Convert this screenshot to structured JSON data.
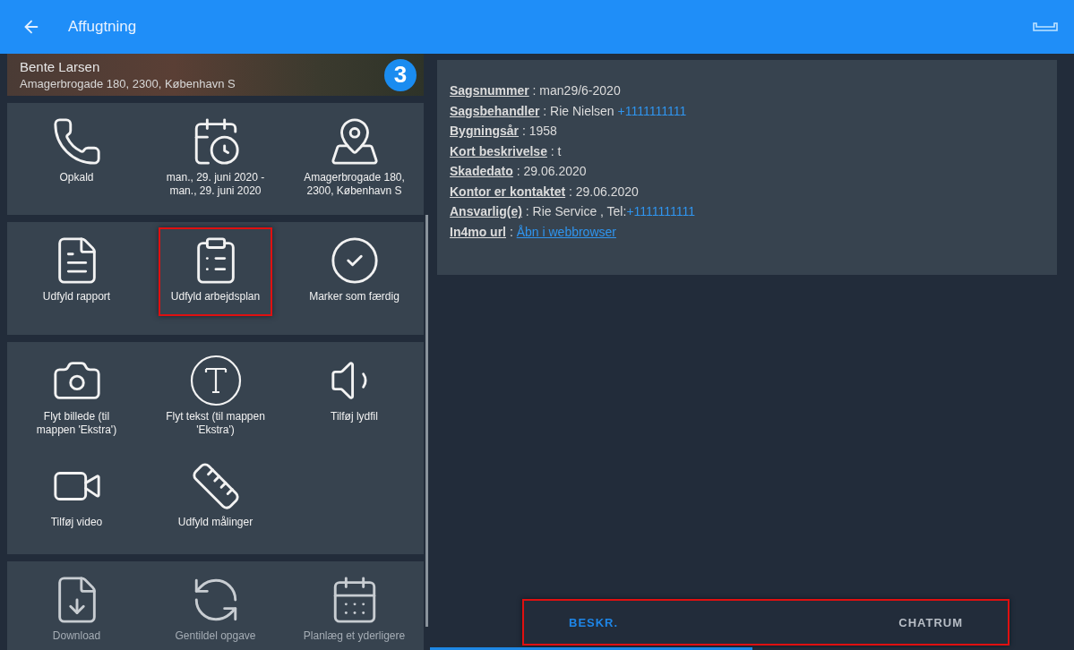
{
  "app_bar": {
    "title": "Affugtning"
  },
  "header": {
    "name": "Bente Larsen",
    "address": "Amagerbrogade 180, 2300, København S",
    "badge": "3"
  },
  "action_cards": [
    {
      "actions": [
        {
          "label": "Opkald",
          "highlighted": false
        },
        {
          "label": "man., 29. juni 2020 - man., 29. juni 2020",
          "highlighted": false
        },
        {
          "label": "Amagerbrogade 180, 2300, København S",
          "highlighted": false
        }
      ]
    },
    {
      "actions": [
        {
          "label": "Udfyld rapport",
          "highlighted": false
        },
        {
          "label": "Udfyld arbejdsplan",
          "highlighted": true
        },
        {
          "label": "Marker som færdig",
          "highlighted": false
        }
      ]
    },
    {
      "actions": [
        {
          "label": "Flyt billede (til mappen 'Ekstra')",
          "highlighted": false
        },
        {
          "label": "Flyt tekst (til mappen 'Ekstra')",
          "highlighted": false
        },
        {
          "label": "Tilføj lydfil",
          "highlighted": false
        },
        {
          "label": "Tilføj video",
          "highlighted": false
        },
        {
          "label": "Udfyld målinger",
          "highlighted": false
        }
      ]
    },
    {
      "actions": [
        {
          "label": "Download",
          "highlighted": false
        },
        {
          "label": "Gentildel opgave",
          "highlighted": false
        },
        {
          "label": "Planlæg et yderligere",
          "highlighted": false
        }
      ]
    }
  ],
  "details": [
    {
      "label": "Sagsnummer",
      "value": " : man29/6-2020"
    },
    {
      "label": "Sagsbehandler",
      "value": " : Rie Nielsen ",
      "link": "+1111111111",
      "kind": "phone"
    },
    {
      "label": "Bygningsår",
      "value": " : 1958"
    },
    {
      "label": "Kort beskrivelse",
      "value": " : t"
    },
    {
      "label": "Skadedato",
      "value": " : 29.06.2020"
    },
    {
      "label": "Kontor er kontaktet",
      "value": " : 29.06.2020"
    },
    {
      "label": "Ansvarlig(e)",
      "value": " : Rie Service , Tel:",
      "link": "+1111111111",
      "kind": "phone"
    },
    {
      "label": "In4mo url",
      "value": " : ",
      "link": "Åbn i webbrowser",
      "kind": "url"
    }
  ],
  "tab_bar": {
    "highlighted": true,
    "tabs": [
      {
        "label": "BESKR.",
        "selected": true
      },
      {
        "label": "CHATRUM",
        "selected": false
      }
    ]
  }
}
